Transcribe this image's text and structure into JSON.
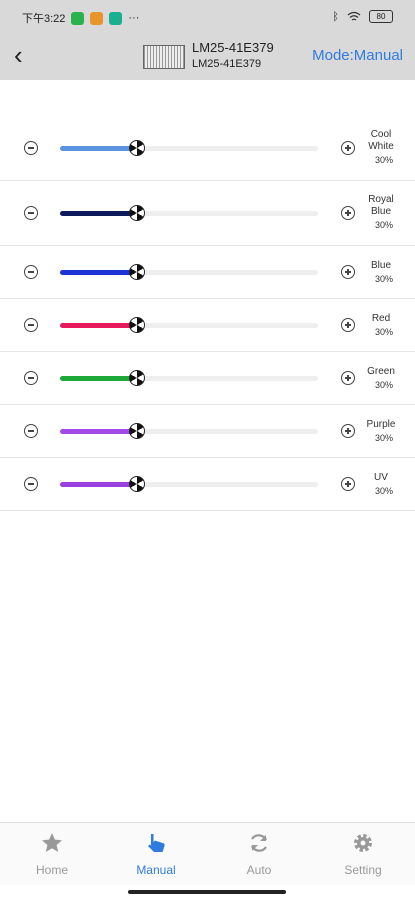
{
  "status_bar": {
    "time": "下午3:22",
    "extra": "···",
    "bluetooth": "ᛒ",
    "battery": "80"
  },
  "header": {
    "device_name": "LM25-41E379",
    "device_sub": "LM25-41E379",
    "mode_label": "Mode:Manual"
  },
  "channels": [
    {
      "name_line1": "Cool",
      "name_line2": "White",
      "percent": 30,
      "percent_label": "30%",
      "color": "#5a93e0"
    },
    {
      "name_line1": "Royal",
      "name_line2": "Blue",
      "percent": 30,
      "percent_label": "30%",
      "color": "#0c1a5c"
    },
    {
      "name_line1": "Blue",
      "name_line2": "",
      "percent": 30,
      "percent_label": "30%",
      "color": "#1a33d6"
    },
    {
      "name_line1": "Red",
      "name_line2": "",
      "percent": 30,
      "percent_label": "30%",
      "color": "#e8195c"
    },
    {
      "name_line1": "Green",
      "name_line2": "",
      "percent": 30,
      "percent_label": "30%",
      "color": "#1fa83a"
    },
    {
      "name_line1": "Purple",
      "name_line2": "",
      "percent": 30,
      "percent_label": "30%",
      "color": "#a24ae8"
    },
    {
      "name_line1": "UV",
      "name_line2": "",
      "percent": 30,
      "percent_label": "30%",
      "color": "#9a3fe0"
    }
  ],
  "nav": {
    "home": "Home",
    "manual": "Manual",
    "auto": "Auto",
    "setting": "Setting",
    "active": "manual"
  },
  "colors": {
    "accent": "#2f7be0",
    "header_bg": "#d9d9d9"
  }
}
